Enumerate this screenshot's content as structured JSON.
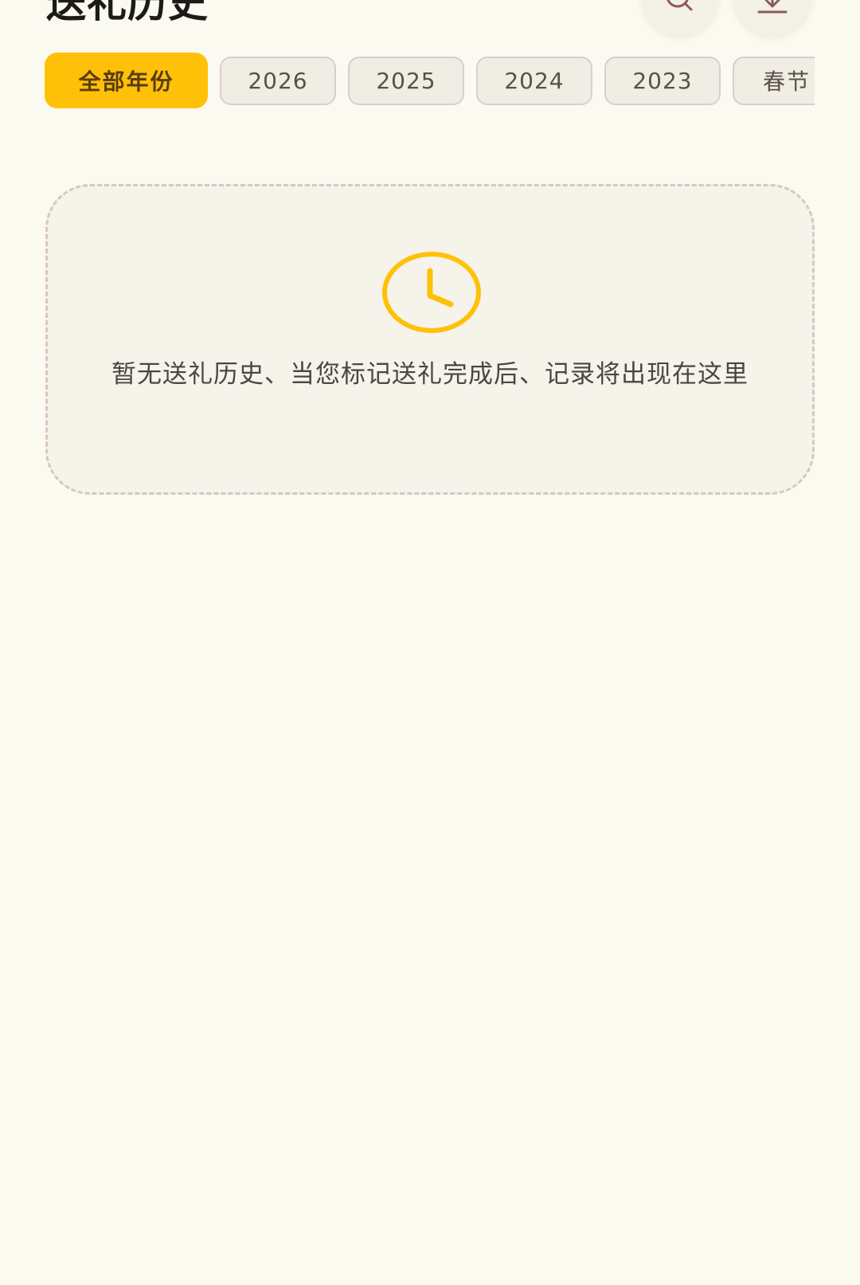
{
  "header": {
    "title": "送礼历史",
    "search_icon": "search-icon",
    "download_icon": "download-icon"
  },
  "filters": {
    "active_index": 0,
    "items": [
      {
        "label": "全部年份",
        "active": true
      },
      {
        "label": "2026",
        "active": false
      },
      {
        "label": "2025",
        "active": false
      },
      {
        "label": "2024",
        "active": false
      },
      {
        "label": "2023",
        "active": false
      },
      {
        "label": "春节",
        "active": false
      }
    ]
  },
  "empty_state": {
    "icon": "clock-icon",
    "message": "暂无送礼历史、当您标记送礼完成后、记录将出现在这里"
  },
  "colors": {
    "background": "#fbfaf0",
    "accent": "#ffc107",
    "icon_stroke": "#8b5b5e",
    "chip_border": "#dccdcb",
    "card_border": "#d9c6c3"
  }
}
